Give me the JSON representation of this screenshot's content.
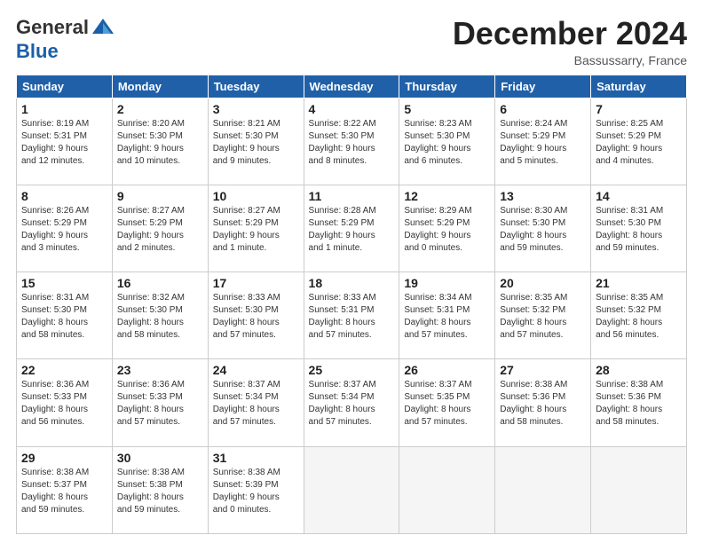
{
  "header": {
    "logo_line1": "General",
    "logo_line2": "Blue",
    "title": "December 2024",
    "subtitle": "Bassussarry, France"
  },
  "weekdays": [
    "Sunday",
    "Monday",
    "Tuesday",
    "Wednesday",
    "Thursday",
    "Friday",
    "Saturday"
  ],
  "weeks": [
    [
      {
        "day": "1",
        "info": "Sunrise: 8:19 AM\nSunset: 5:31 PM\nDaylight: 9 hours\nand 12 minutes."
      },
      {
        "day": "2",
        "info": "Sunrise: 8:20 AM\nSunset: 5:30 PM\nDaylight: 9 hours\nand 10 minutes."
      },
      {
        "day": "3",
        "info": "Sunrise: 8:21 AM\nSunset: 5:30 PM\nDaylight: 9 hours\nand 9 minutes."
      },
      {
        "day": "4",
        "info": "Sunrise: 8:22 AM\nSunset: 5:30 PM\nDaylight: 9 hours\nand 8 minutes."
      },
      {
        "day": "5",
        "info": "Sunrise: 8:23 AM\nSunset: 5:30 PM\nDaylight: 9 hours\nand 6 minutes."
      },
      {
        "day": "6",
        "info": "Sunrise: 8:24 AM\nSunset: 5:29 PM\nDaylight: 9 hours\nand 5 minutes."
      },
      {
        "day": "7",
        "info": "Sunrise: 8:25 AM\nSunset: 5:29 PM\nDaylight: 9 hours\nand 4 minutes."
      }
    ],
    [
      {
        "day": "8",
        "info": "Sunrise: 8:26 AM\nSunset: 5:29 PM\nDaylight: 9 hours\nand 3 minutes."
      },
      {
        "day": "9",
        "info": "Sunrise: 8:27 AM\nSunset: 5:29 PM\nDaylight: 9 hours\nand 2 minutes."
      },
      {
        "day": "10",
        "info": "Sunrise: 8:27 AM\nSunset: 5:29 PM\nDaylight: 9 hours\nand 1 minute."
      },
      {
        "day": "11",
        "info": "Sunrise: 8:28 AM\nSunset: 5:29 PM\nDaylight: 9 hours\nand 1 minute."
      },
      {
        "day": "12",
        "info": "Sunrise: 8:29 AM\nSunset: 5:29 PM\nDaylight: 9 hours\nand 0 minutes."
      },
      {
        "day": "13",
        "info": "Sunrise: 8:30 AM\nSunset: 5:30 PM\nDaylight: 8 hours\nand 59 minutes."
      },
      {
        "day": "14",
        "info": "Sunrise: 8:31 AM\nSunset: 5:30 PM\nDaylight: 8 hours\nand 59 minutes."
      }
    ],
    [
      {
        "day": "15",
        "info": "Sunrise: 8:31 AM\nSunset: 5:30 PM\nDaylight: 8 hours\nand 58 minutes."
      },
      {
        "day": "16",
        "info": "Sunrise: 8:32 AM\nSunset: 5:30 PM\nDaylight: 8 hours\nand 58 minutes."
      },
      {
        "day": "17",
        "info": "Sunrise: 8:33 AM\nSunset: 5:30 PM\nDaylight: 8 hours\nand 57 minutes."
      },
      {
        "day": "18",
        "info": "Sunrise: 8:33 AM\nSunset: 5:31 PM\nDaylight: 8 hours\nand 57 minutes."
      },
      {
        "day": "19",
        "info": "Sunrise: 8:34 AM\nSunset: 5:31 PM\nDaylight: 8 hours\nand 57 minutes."
      },
      {
        "day": "20",
        "info": "Sunrise: 8:35 AM\nSunset: 5:32 PM\nDaylight: 8 hours\nand 57 minutes."
      },
      {
        "day": "21",
        "info": "Sunrise: 8:35 AM\nSunset: 5:32 PM\nDaylight: 8 hours\nand 56 minutes."
      }
    ],
    [
      {
        "day": "22",
        "info": "Sunrise: 8:36 AM\nSunset: 5:33 PM\nDaylight: 8 hours\nand 56 minutes."
      },
      {
        "day": "23",
        "info": "Sunrise: 8:36 AM\nSunset: 5:33 PM\nDaylight: 8 hours\nand 57 minutes."
      },
      {
        "day": "24",
        "info": "Sunrise: 8:37 AM\nSunset: 5:34 PM\nDaylight: 8 hours\nand 57 minutes."
      },
      {
        "day": "25",
        "info": "Sunrise: 8:37 AM\nSunset: 5:34 PM\nDaylight: 8 hours\nand 57 minutes."
      },
      {
        "day": "26",
        "info": "Sunrise: 8:37 AM\nSunset: 5:35 PM\nDaylight: 8 hours\nand 57 minutes."
      },
      {
        "day": "27",
        "info": "Sunrise: 8:38 AM\nSunset: 5:36 PM\nDaylight: 8 hours\nand 58 minutes."
      },
      {
        "day": "28",
        "info": "Sunrise: 8:38 AM\nSunset: 5:36 PM\nDaylight: 8 hours\nand 58 minutes."
      }
    ],
    [
      {
        "day": "29",
        "info": "Sunrise: 8:38 AM\nSunset: 5:37 PM\nDaylight: 8 hours\nand 59 minutes."
      },
      {
        "day": "30",
        "info": "Sunrise: 8:38 AM\nSunset: 5:38 PM\nDaylight: 8 hours\nand 59 minutes."
      },
      {
        "day": "31",
        "info": "Sunrise: 8:38 AM\nSunset: 5:39 PM\nDaylight: 9 hours\nand 0 minutes."
      },
      {
        "day": "",
        "info": ""
      },
      {
        "day": "",
        "info": ""
      },
      {
        "day": "",
        "info": ""
      },
      {
        "day": "",
        "info": ""
      }
    ]
  ]
}
